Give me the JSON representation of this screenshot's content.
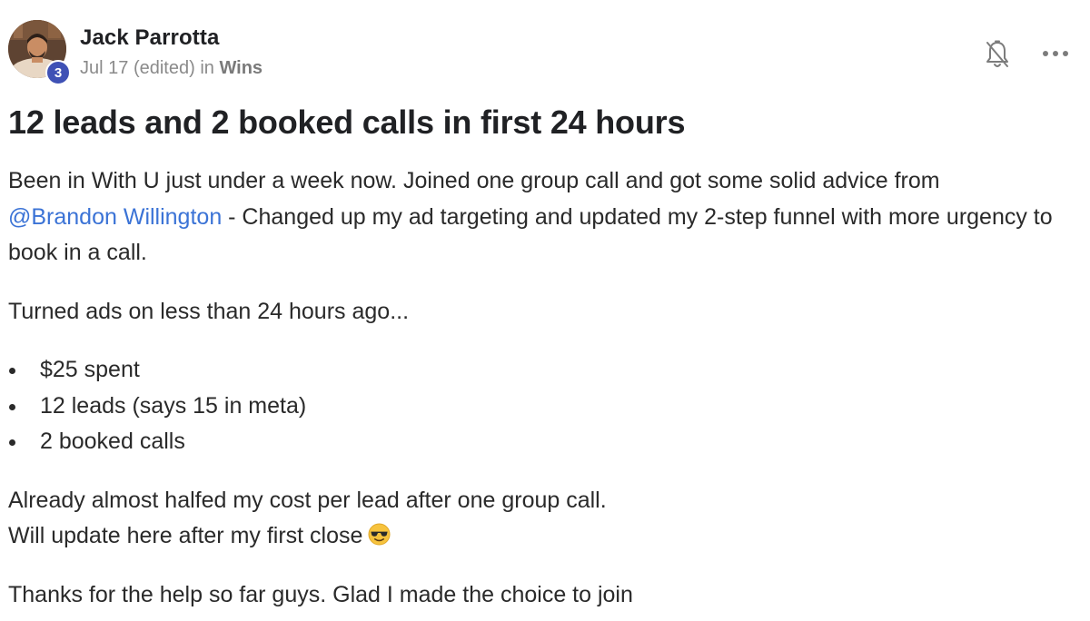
{
  "author": {
    "name": "Jack Parrotta",
    "level": "3"
  },
  "meta": {
    "date": "Jul 17",
    "edited": "(edited)",
    "in_word": "in",
    "category": "Wins"
  },
  "icons": {
    "bell": "bell-off-icon",
    "more": "more-horizontal-icon",
    "emoji": "smiling-face-with-sunglasses-emoji"
  },
  "colors": {
    "level_badge": "#3f51b5",
    "mention": "#3b73d6",
    "meta_text": "#8a8a8a"
  },
  "post": {
    "title": "12 leads and 2 booked calls in first 24 hours",
    "paragraph_1_intro": "Been in With U just under a week now. Joined one group call and got some solid advice from",
    "mention": "@Brandon Willington",
    "paragraph_1_rest": " - Changed up my ad targeting and updated my 2-step funnel with more urgency to book in a call.",
    "paragraph_2": "Turned ads on less than 24 hours ago...",
    "bullets": [
      "$25 spent",
      "12 leads (says 15 in meta)",
      "2 booked calls"
    ],
    "paragraph_4_line_1": "Already almost halfed my cost per lead after one group call.",
    "paragraph_4_line_2": "Will update here after my first close",
    "paragraph_5": "Thanks for the help so far guys. Glad I made the choice to join"
  }
}
